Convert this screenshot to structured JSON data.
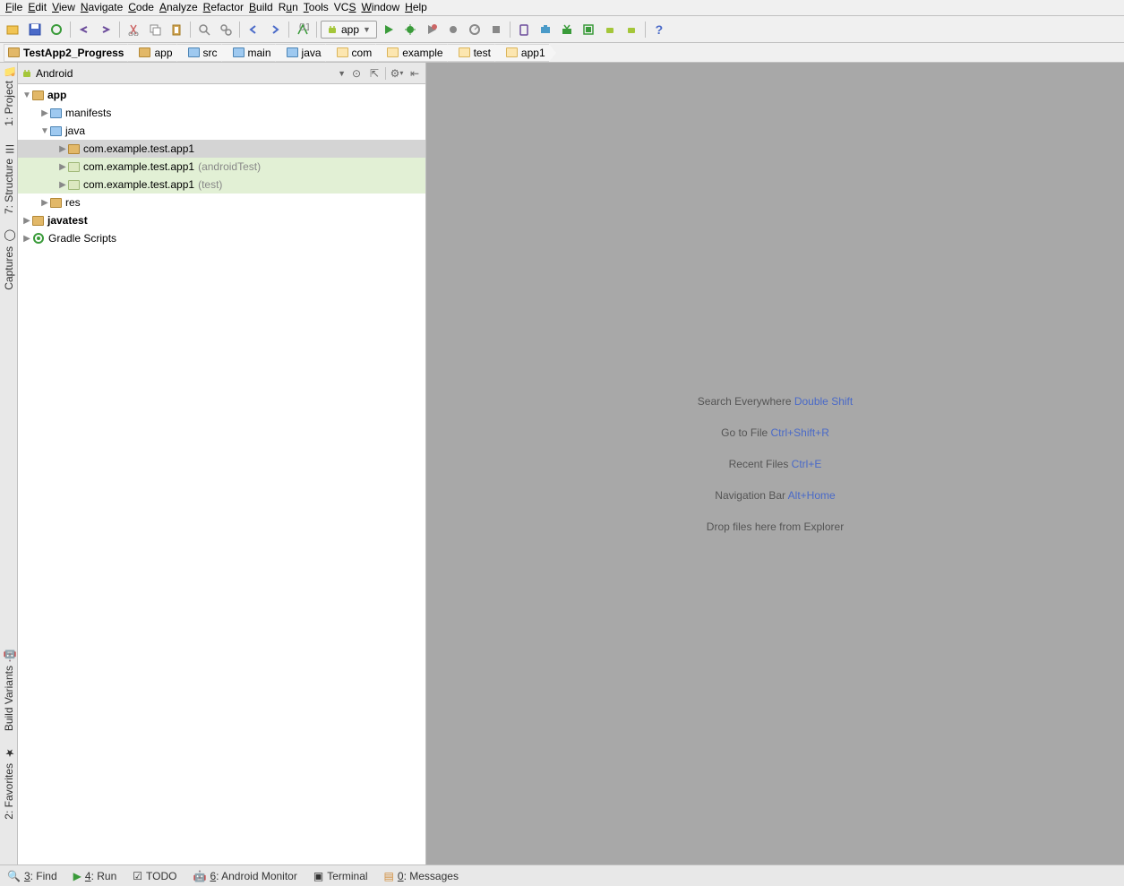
{
  "menu": [
    "File",
    "Edit",
    "View",
    "Navigate",
    "Code",
    "Analyze",
    "Refactor",
    "Build",
    "Run",
    "Tools",
    "VCS",
    "Window",
    "Help"
  ],
  "menu_keys": [
    "F",
    "E",
    "V",
    "N",
    "C",
    "A",
    "R",
    "B",
    "u",
    "T",
    "S",
    "W",
    "H"
  ],
  "run_config": {
    "label": "app"
  },
  "breadcrumb": [
    "TestApp2_Progress",
    "app",
    "src",
    "main",
    "java",
    "com",
    "example",
    "test",
    "app1"
  ],
  "project_view": {
    "mode": "Android"
  },
  "tree": {
    "app": "app",
    "manifests": "manifests",
    "java": "java",
    "pkg1": "com.example.test.app1",
    "pkg2": "com.example.test.app1",
    "pkg2_suffix": "(androidTest)",
    "pkg3": "com.example.test.app1",
    "pkg3_suffix": "(test)",
    "res": "res",
    "javatest": "javatest",
    "gradle": "Gradle Scripts"
  },
  "left_tabs": {
    "project": "1: Project",
    "structure": "7: Structure",
    "captures": "Captures",
    "build": "Build Variants",
    "fav": "2: Favorites"
  },
  "empty": {
    "l1a": "Search Everywhere ",
    "l1b": "Double Shift",
    "l2a": "Go to File ",
    "l2b": "Ctrl+Shift+R",
    "l3a": "Recent Files ",
    "l3b": "Ctrl+E",
    "l4a": "Navigation Bar ",
    "l4b": "Alt+Home",
    "l5": "Drop files here from Explorer"
  },
  "bottom": {
    "find": "3: Find",
    "run": "4: Run",
    "todo": "TODO",
    "monitor": "6: Android Monitor",
    "terminal": "Terminal",
    "messages": "0: Messages"
  }
}
